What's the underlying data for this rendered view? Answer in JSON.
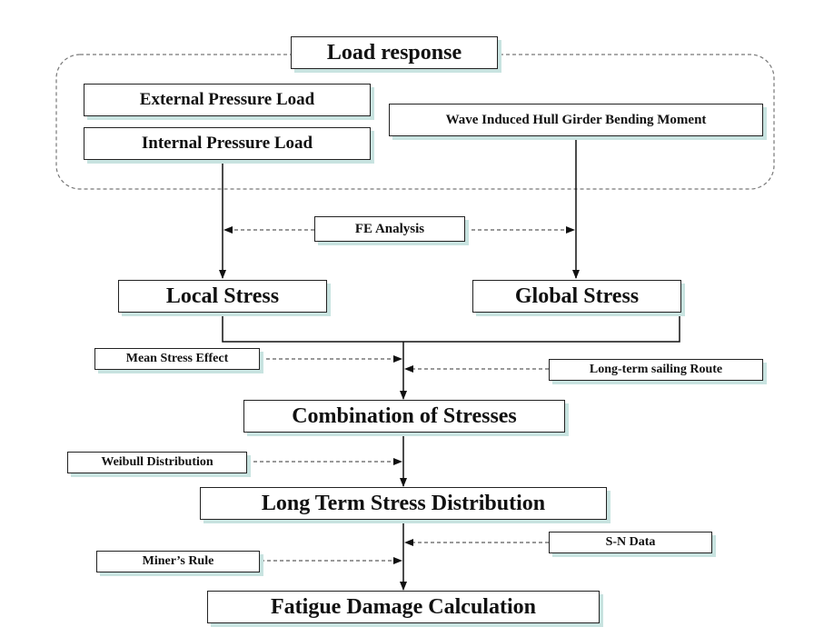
{
  "load_response": {
    "title": "Load response",
    "external_pressure": "External Pressure Load",
    "internal_pressure": "Internal Pressure Load",
    "wave_bending": "Wave Induced Hull Girder Bending Moment"
  },
  "fe_analysis": "FE Analysis",
  "local_stress": "Local Stress",
  "global_stress": "Global Stress",
  "mean_stress_effect": "Mean Stress Effect",
  "long_term_sailing_route": "Long-term sailing Route",
  "combination_of_stresses": "Combination of Stresses",
  "weibull_distribution": "Weibull Distribution",
  "long_term_stress_distribution": "Long Term Stress Distribution",
  "sn_data": "S-N Data",
  "miners_rule": "Miner’s Rule",
  "fatigue_damage_calculation": "Fatigue Damage Calculation",
  "colors": {
    "line": "#111111",
    "shadow": "#c8e3e0"
  }
}
